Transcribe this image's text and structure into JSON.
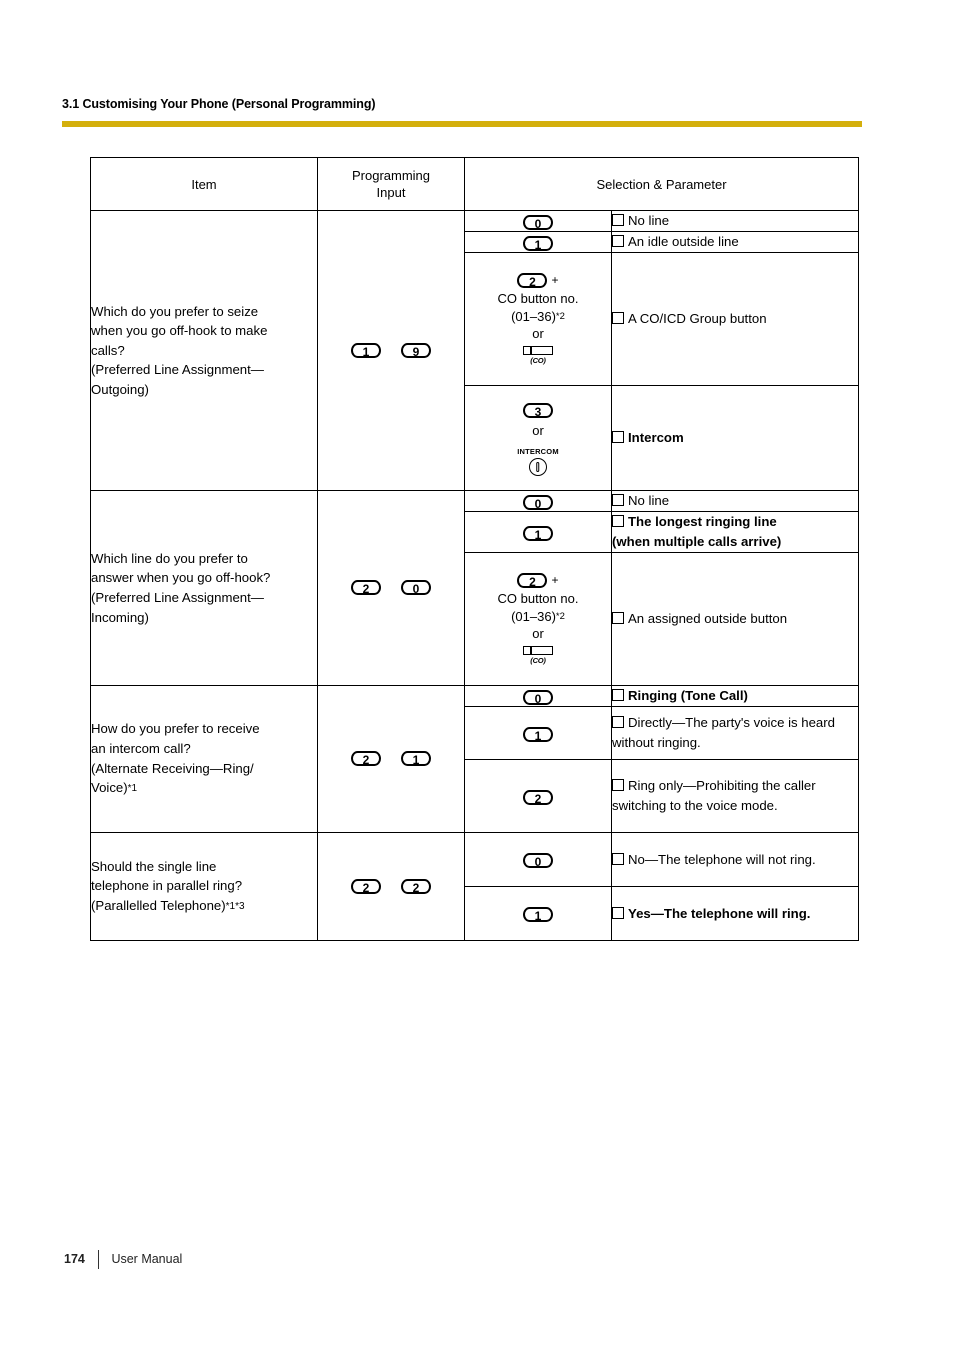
{
  "header": {
    "section_title": "3.1 Customising Your Phone (Personal Programming)",
    "rule_color": "#d4af0c"
  },
  "table": {
    "columns": [
      {
        "label": "Item"
      },
      {
        "label": "Programming\nInput",
        "line1": "Programming",
        "line2": "Input"
      },
      {
        "label": "Selection & Parameter"
      }
    ],
    "rows": [
      {
        "item": {
          "line1": "Which do you prefer to seize",
          "line2": "when you go off-hook to make",
          "line3": "calls?",
          "line4": "(Preferred Line Assignment—",
          "line5": "Outgoing)"
        },
        "input_keys": [
          "1",
          "9"
        ],
        "options": [
          {
            "keys": [
              "0"
            ],
            "param": "No line",
            "bold": false
          },
          {
            "keys": [
              "1"
            ],
            "param": "An idle outside line",
            "bold": false
          },
          {
            "keys": [
              "2"
            ],
            "plus": "+",
            "note_line1": "CO button no.",
            "note_line2": "(01–36)",
            "note_sup": "*2",
            "or": "or",
            "icon": "co-button-icon",
            "icon_label": "(CO)",
            "param": "A CO/ICD Group button",
            "bold": false
          },
          {
            "keys": [
              "3"
            ],
            "or": "or",
            "icon": "intercom-button-icon",
            "icon_label": "INTERCOM",
            "param": "Intercom",
            "bold": true
          }
        ]
      },
      {
        "item": {
          "line1": "Which line do you prefer to",
          "line2": "answer when you go off-hook?",
          "line3": "(Preferred Line Assignment—",
          "line4": "Incoming)"
        },
        "input_keys": [
          "2",
          "0"
        ],
        "options": [
          {
            "keys": [
              "0"
            ],
            "param": "No line",
            "bold": false
          },
          {
            "keys": [
              "1"
            ],
            "param_line1": "The longest ringing line",
            "param_line2": "(when multiple calls arrive)",
            "bold": true
          },
          {
            "keys": [
              "2"
            ],
            "plus": "+",
            "note_line1": "CO button no.",
            "note_line2": "(01–36)",
            "note_sup": "*2",
            "or": "or",
            "icon": "co-button-icon",
            "icon_label": "(CO)",
            "param": "An assigned outside button",
            "bold": false
          }
        ]
      },
      {
        "item": {
          "line1": "How do you prefer to receive",
          "line2": "an intercom call?",
          "line3": "(Alternate Receiving—Ring/",
          "line4": "Voice)",
          "sup": "*1"
        },
        "input_keys": [
          "2",
          "1"
        ],
        "options": [
          {
            "keys": [
              "0"
            ],
            "param": "Ringing (Tone Call)",
            "bold": true
          },
          {
            "keys": [
              "1"
            ],
            "param": "Directly—The party's voice is heard without ringing.",
            "bold": false
          },
          {
            "keys": [
              "2"
            ],
            "param": "Ring only—Prohibiting the caller switching to the voice mode.",
            "bold": false
          }
        ]
      },
      {
        "item": {
          "line1": "Should the single line",
          "line2": "telephone in parallel ring?",
          "line3": "(Parallelled Telephone)",
          "sup": "*1*3"
        },
        "input_keys": [
          "2",
          "2"
        ],
        "options": [
          {
            "keys": [
              "0"
            ],
            "param": "No—The telephone will not ring.",
            "bold": false
          },
          {
            "keys": [
              "1"
            ],
            "param": "Yes—The telephone will ring.",
            "bold": true
          }
        ]
      }
    ]
  },
  "footer": {
    "page_number": "174",
    "manual_label": "User Manual"
  }
}
